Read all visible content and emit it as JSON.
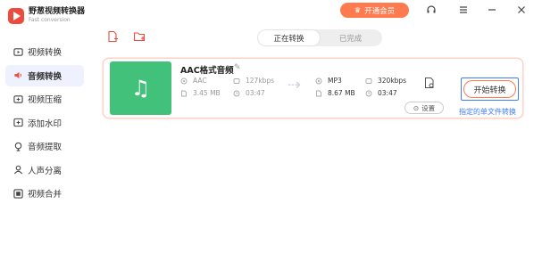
{
  "app": {
    "name": "野葱视频转换器",
    "subtitle": "Fast conversion"
  },
  "header": {
    "vip_label": "开通会员",
    "icons": [
      "headset-icon",
      "menu-icon",
      "minimize-icon",
      "close-icon"
    ]
  },
  "sidebar": {
    "items": [
      {
        "label": "视频转换",
        "icon": "video-convert-icon",
        "active": false
      },
      {
        "label": "音频转换",
        "icon": "audio-convert-icon",
        "active": true
      },
      {
        "label": "视频压缩",
        "icon": "video-compress-icon",
        "active": false
      },
      {
        "label": "添加水印",
        "icon": "watermark-icon",
        "active": false
      },
      {
        "label": "音频提取",
        "icon": "audio-extract-icon",
        "active": false
      },
      {
        "label": "人声分离",
        "icon": "vocal-separate-icon",
        "active": false
      },
      {
        "label": "视频合并",
        "icon": "video-merge-icon",
        "active": false
      }
    ],
    "accent": "#eef2ff"
  },
  "toolbar": {
    "tabs": [
      {
        "label": "正在转换",
        "active": true
      },
      {
        "label": "已完成",
        "active": false
      }
    ],
    "icons": [
      "add-file-icon",
      "add-folder-icon"
    ]
  },
  "file_card": {
    "name": "AAC格式音频",
    "source": {
      "format": "AAC",
      "bitrate": "127kbps",
      "size": "3.45 MB",
      "duration": "03:47"
    },
    "target": {
      "format": "MP3",
      "bitrate": "320kbps",
      "size": "8.67 MB",
      "duration": "03:47"
    },
    "settings_label": "设置",
    "start_label": "开始转换",
    "single_convert_link": "指定的单文件转换"
  },
  "colors": {
    "brand": "#ee4b3f",
    "vip": "#ff7a4f",
    "thumb": "#42c17a",
    "link": "#3f7bff"
  }
}
